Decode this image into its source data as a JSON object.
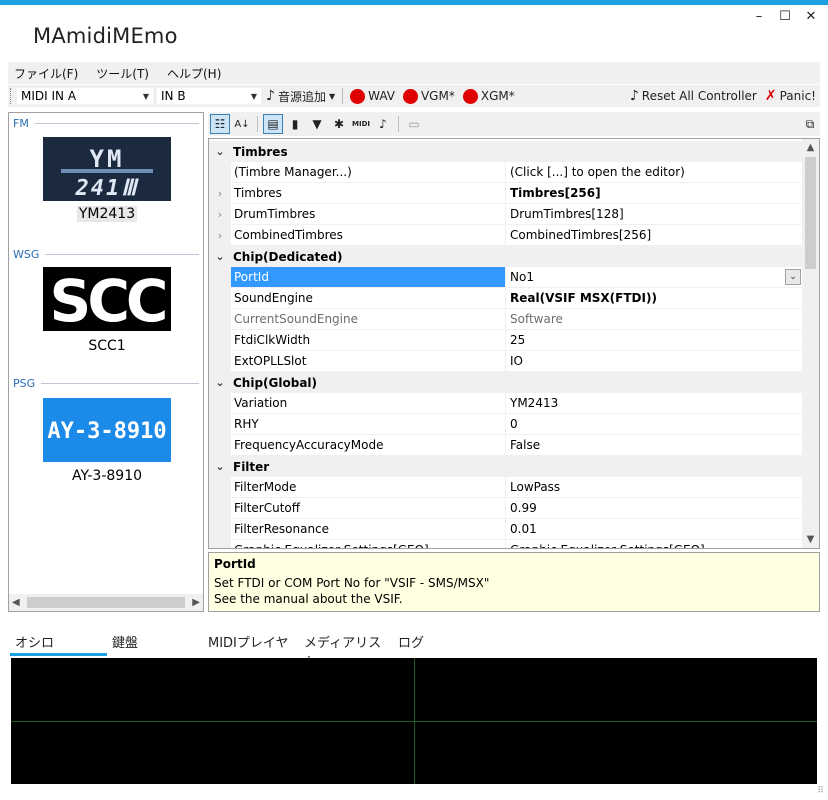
{
  "window": {
    "title": "MAmidiMEmo",
    "controls": {
      "minimize": "–",
      "maximize": "☐",
      "close": "✕"
    }
  },
  "menubar": {
    "items": [
      "ファイル(F)",
      "ツール(T)",
      "ヘルプ(H)"
    ]
  },
  "toolbar": {
    "midi_in_a": "MIDI IN A",
    "midi_in_b": "IN B",
    "add_chip": "音源追加",
    "wav": "WAV",
    "vgm": "VGM*",
    "xgm": "XGM*",
    "reset_all": "Reset All Controller",
    "panic": "Panic!"
  },
  "left_panel": {
    "groups": [
      {
        "header": "FM",
        "chip_logo": "YM 2413",
        "label": "YM2413"
      },
      {
        "header": "WSG",
        "chip_logo": "SCC",
        "label": "SCC1"
      },
      {
        "header": "PSG",
        "chip_logo": "AY-3-8910",
        "label": "AY-3-8910"
      }
    ]
  },
  "property_toolbar": {
    "icons": [
      "categorized-icon",
      "alphabetical-icon",
      "properties-icon",
      "device-icon",
      "filter-icon",
      "gear-icon",
      "midi-icon",
      "note-icon",
      "pages-icon"
    ],
    "midi_text": "MIDI"
  },
  "grid": {
    "rows": [
      {
        "kind": "category",
        "name": "Timbres"
      },
      {
        "kind": "prop",
        "name": "(Timbre Manager...)",
        "value": "(Click [...] to open the editor)"
      },
      {
        "kind": "prop",
        "expand": true,
        "name": "Timbres",
        "value": "Timbres[256]",
        "bold": true
      },
      {
        "kind": "prop",
        "expand": true,
        "name": "DrumTimbres",
        "value": "DrumTimbres[128]"
      },
      {
        "kind": "prop",
        "expand": true,
        "name": "CombinedTimbres",
        "value": "CombinedTimbres[256]"
      },
      {
        "kind": "category",
        "name": "Chip(Dedicated)"
      },
      {
        "kind": "prop",
        "name": "PortId",
        "value": "No1",
        "selected": true,
        "dropdown": true
      },
      {
        "kind": "prop",
        "name": "SoundEngine",
        "value": "Real(VSIF MSX(FTDI))",
        "bold": true
      },
      {
        "kind": "prop",
        "name": "CurrentSoundEngine",
        "value": "Software",
        "disabled": true
      },
      {
        "kind": "prop",
        "name": "FtdiClkWidth",
        "value": "25"
      },
      {
        "kind": "prop",
        "name": "ExtOPLLSlot",
        "value": "IO"
      },
      {
        "kind": "category",
        "name": "Chip(Global)"
      },
      {
        "kind": "prop",
        "name": "Variation",
        "value": "YM2413"
      },
      {
        "kind": "prop",
        "name": "RHY",
        "value": "0"
      },
      {
        "kind": "prop",
        "name": "FrequencyAccuracyMode",
        "value": "False"
      },
      {
        "kind": "category",
        "name": "Filter"
      },
      {
        "kind": "prop",
        "name": "FilterMode",
        "value": "LowPass"
      },
      {
        "kind": "prop",
        "name": "FilterCutoff",
        "value": "0.99"
      },
      {
        "kind": "prop",
        "name": "FilterResonance",
        "value": "0.01"
      },
      {
        "kind": "prop",
        "expand": true,
        "name": "Graphic Equalizer Settings[GEQ]",
        "value": "Graphic Equalizer Settings[GEQ]"
      }
    ]
  },
  "description": {
    "title": "PortId",
    "line1": "Set FTDI or COM Port No for \"VSIF - SMS/MSX\"",
    "line2": "See the manual about the VSIF."
  },
  "bottom_tabs": {
    "items": [
      "オシロ",
      "鍵盤",
      "MIDIプレイヤー",
      "メディアリスト",
      "ログ"
    ],
    "active": "オシロ"
  },
  "colors": {
    "accent": "#1ba1e2",
    "selection": "#3399ff",
    "record_red": "#e00000",
    "scope_bg": "#000000",
    "scope_grid": "#1a5c1a",
    "desc_bg": "#ffffe1"
  }
}
